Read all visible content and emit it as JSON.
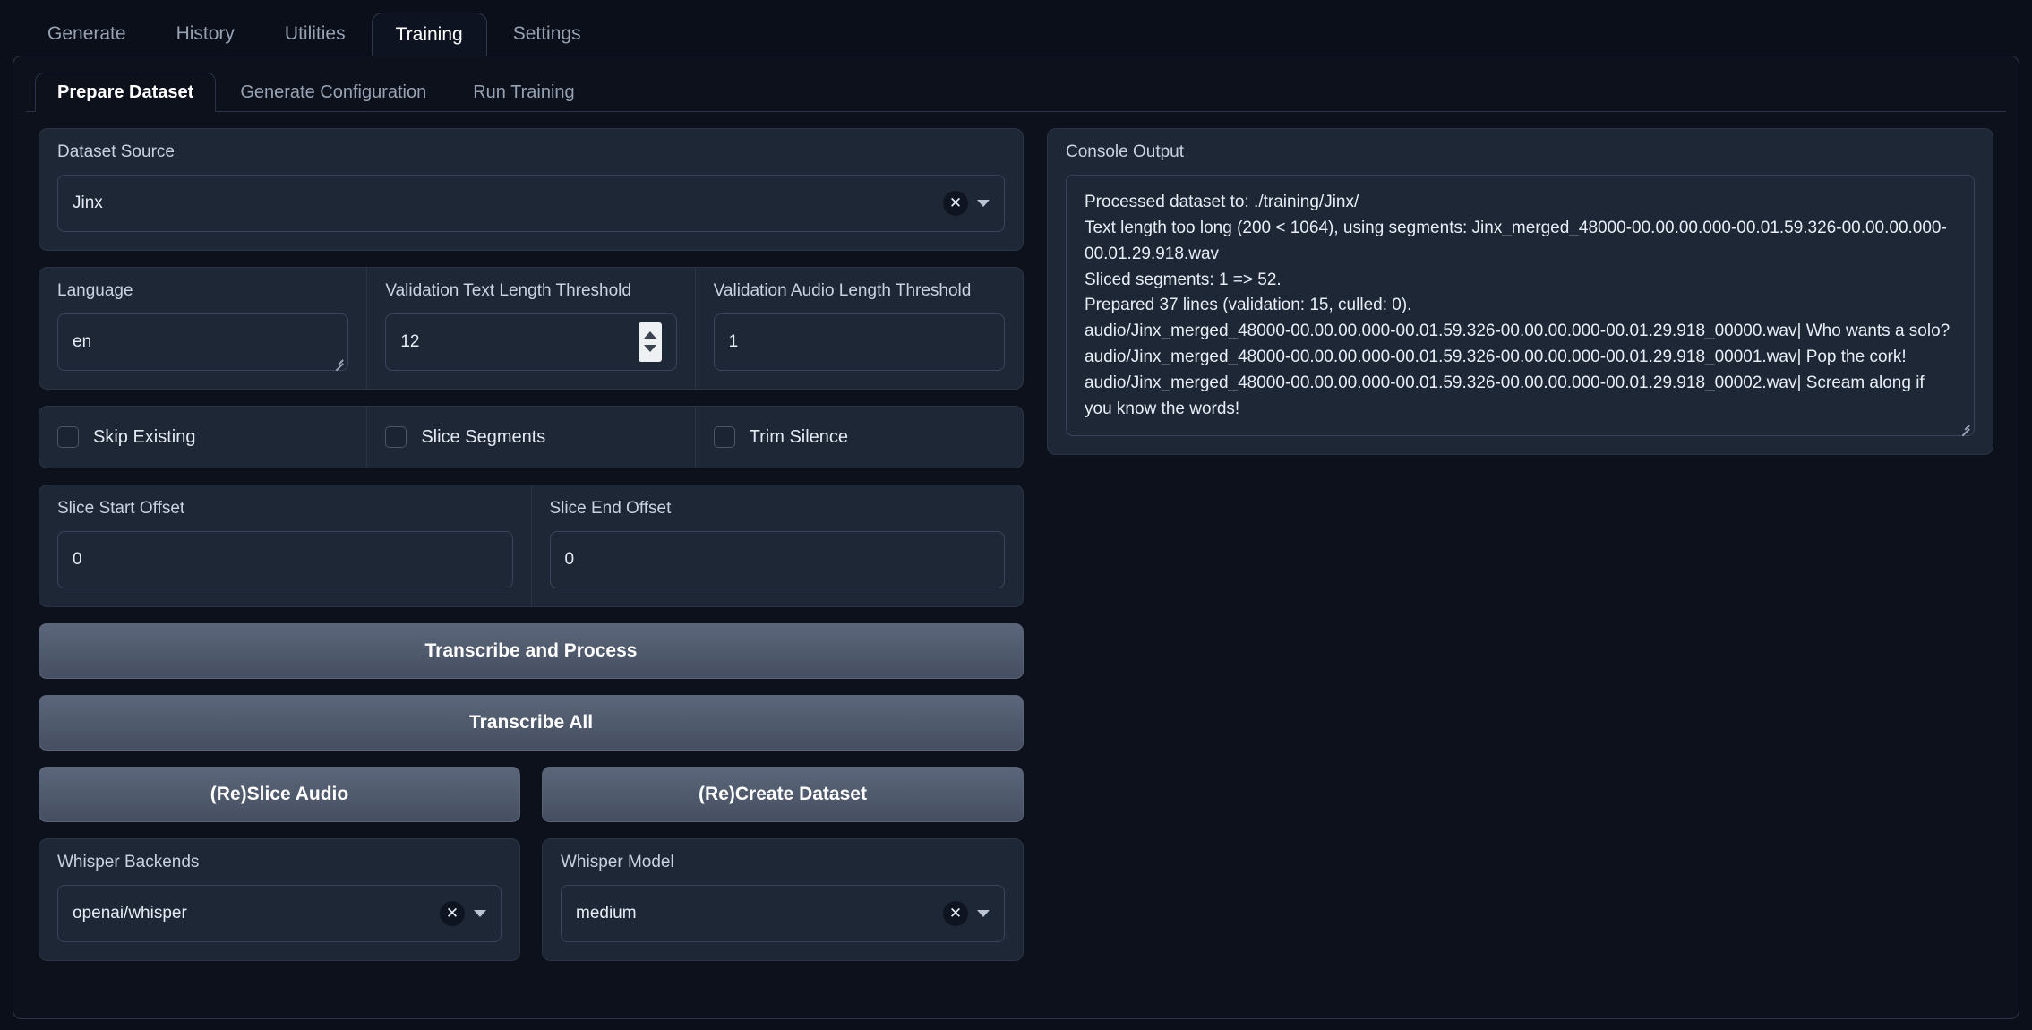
{
  "top_tabs": [
    {
      "label": "Generate",
      "active": false
    },
    {
      "label": "History",
      "active": false
    },
    {
      "label": "Utilities",
      "active": false
    },
    {
      "label": "Training",
      "active": true
    },
    {
      "label": "Settings",
      "active": false
    }
  ],
  "sub_tabs": [
    {
      "label": "Prepare Dataset",
      "active": true
    },
    {
      "label": "Generate Configuration",
      "active": false
    },
    {
      "label": "Run Training",
      "active": false
    }
  ],
  "dataset_source": {
    "label": "Dataset Source",
    "value": "Jinx",
    "clear_icon": "close-icon",
    "caret_icon": "chevron-down-icon"
  },
  "params": {
    "language": {
      "label": "Language",
      "value": "en"
    },
    "validation_text_length": {
      "label": "Validation Text Length Threshold",
      "value": "12"
    },
    "validation_audio_length": {
      "label": "Validation Audio Length Threshold",
      "value": "1"
    }
  },
  "checkboxes": [
    {
      "label": "Skip Existing",
      "checked": false
    },
    {
      "label": "Slice Segments",
      "checked": false
    },
    {
      "label": "Trim Silence",
      "checked": false
    }
  ],
  "offsets": {
    "slice_start": {
      "label": "Slice Start Offset",
      "value": "0"
    },
    "slice_end": {
      "label": "Slice End Offset",
      "value": "0"
    }
  },
  "buttons": {
    "transcribe_and_process": "Transcribe and Process",
    "transcribe_all": "Transcribe All",
    "reslice_audio": "(Re)Slice Audio",
    "recreate_dataset": "(Re)Create Dataset"
  },
  "whisper": {
    "backends": {
      "label": "Whisper Backends",
      "value": "openai/whisper"
    },
    "model": {
      "label": "Whisper Model",
      "value": "medium"
    }
  },
  "console": {
    "label": "Console Output",
    "lines": [
      "Processed dataset to: ./training/Jinx/",
      "Text length too long (200 < 1064), using segments: Jinx_merged_48000-00.00.00.000-00.01.59.326-00.00.00.000-00.01.29.918.wav",
      "Sliced segments: 1 => 52.",
      "Prepared 37 lines (validation: 15, culled: 0).",
      "audio/Jinx_merged_48000-00.00.00.000-00.01.59.326-00.00.00.000-00.01.29.918_00000.wav| Who wants a solo?",
      "audio/Jinx_merged_48000-00.00.00.000-00.01.59.326-00.00.00.000-00.01.29.918_00001.wav| Pop the cork!",
      "audio/Jinx_merged_48000-00.00.00.000-00.01.59.326-00.00.00.000-00.01.29.918_00002.wav| Scream along if you know the words!"
    ]
  },
  "colors": {
    "background": "#0b0f19",
    "panel": "#1e2736",
    "border": "#2b3446",
    "text": "#e8eef7",
    "muted": "#97a2b3",
    "button": "#4f5a6e"
  }
}
